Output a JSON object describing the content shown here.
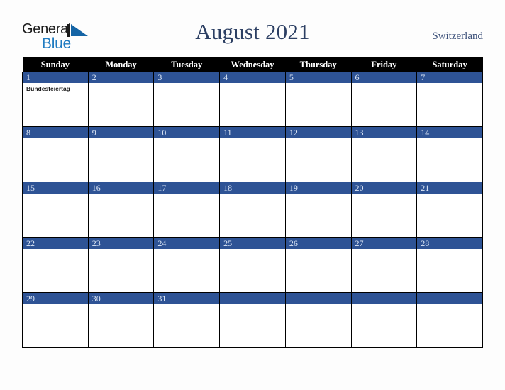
{
  "logo": {
    "word_one": "General",
    "word_two": "Blue",
    "mark": "triangle-mark",
    "color_general": "#1a1a1a",
    "color_blue": "#1f7bc1"
  },
  "header": {
    "title": "August 2021",
    "country": "Switzerland",
    "title_color": "#2c3f63",
    "country_color": "#3d517a"
  },
  "calendar": {
    "header_background": "#000000",
    "header_text_color": "#ffffff",
    "daybar_background": "#2e5395",
    "daybar_text_color": "#dce6f5",
    "cell_background": "#ffffff",
    "border_color": "#000000",
    "weekday_headers": [
      "Sunday",
      "Monday",
      "Tuesday",
      "Wednesday",
      "Thursday",
      "Friday",
      "Saturday"
    ],
    "weeks": [
      [
        {
          "day": "1",
          "events": [
            "Bundesfeiertag"
          ]
        },
        {
          "day": "2",
          "events": []
        },
        {
          "day": "3",
          "events": []
        },
        {
          "day": "4",
          "events": []
        },
        {
          "day": "5",
          "events": []
        },
        {
          "day": "6",
          "events": []
        },
        {
          "day": "7",
          "events": []
        }
      ],
      [
        {
          "day": "8",
          "events": []
        },
        {
          "day": "9",
          "events": []
        },
        {
          "day": "10",
          "events": []
        },
        {
          "day": "11",
          "events": []
        },
        {
          "day": "12",
          "events": []
        },
        {
          "day": "13",
          "events": []
        },
        {
          "day": "14",
          "events": []
        }
      ],
      [
        {
          "day": "15",
          "events": []
        },
        {
          "day": "16",
          "events": []
        },
        {
          "day": "17",
          "events": []
        },
        {
          "day": "18",
          "events": []
        },
        {
          "day": "19",
          "events": []
        },
        {
          "day": "20",
          "events": []
        },
        {
          "day": "21",
          "events": []
        }
      ],
      [
        {
          "day": "22",
          "events": []
        },
        {
          "day": "23",
          "events": []
        },
        {
          "day": "24",
          "events": []
        },
        {
          "day": "25",
          "events": []
        },
        {
          "day": "26",
          "events": []
        },
        {
          "day": "27",
          "events": []
        },
        {
          "day": "28",
          "events": []
        }
      ],
      [
        {
          "day": "29",
          "events": []
        },
        {
          "day": "30",
          "events": []
        },
        {
          "day": "31",
          "events": []
        },
        {
          "day": "",
          "events": []
        },
        {
          "day": "",
          "events": []
        },
        {
          "day": "",
          "events": []
        },
        {
          "day": "",
          "events": []
        }
      ]
    ]
  }
}
